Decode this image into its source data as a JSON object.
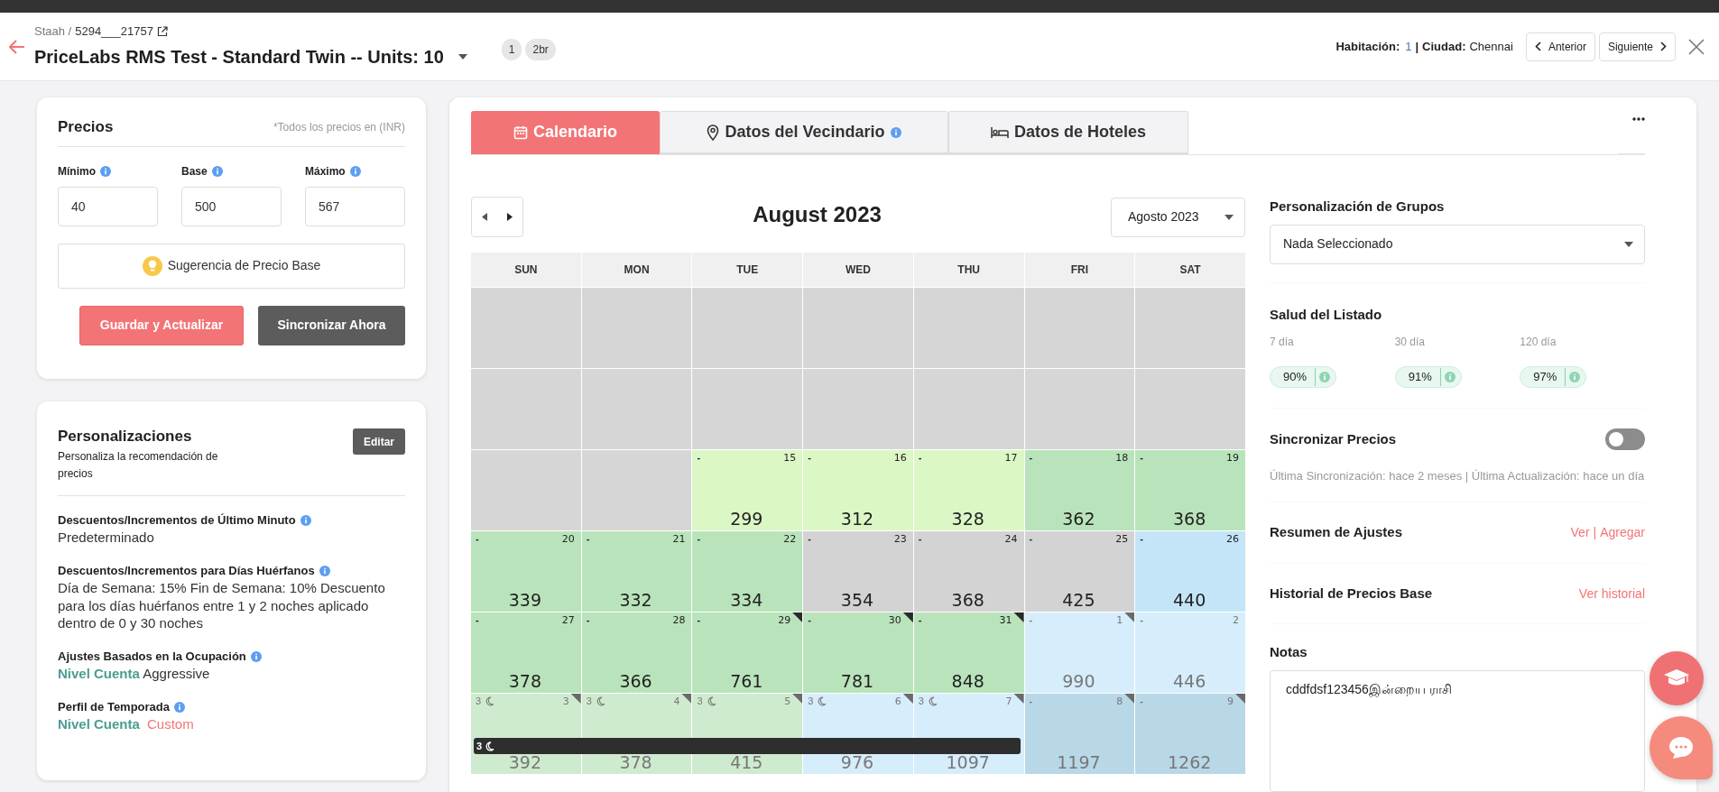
{
  "header": {
    "source": "Staah /",
    "listing_id": "5294___21757",
    "title": "PriceLabs RMS Test - Standard Twin -- Units: 10",
    "badges": [
      "1",
      "2br"
    ],
    "room_label": "Habitación:",
    "room": "1",
    "separator": "|",
    "city_label": "Ciudad:",
    "city": "Chennai",
    "prev_button": "Anterior",
    "next_button": "Siguiente"
  },
  "prices": {
    "title": "Precios",
    "currency_note": "*Todos los precios en (INR)",
    "fields": [
      {
        "label": "Mínimo",
        "value": "40"
      },
      {
        "label": "Base",
        "value": "500"
      },
      {
        "label": "Máximo",
        "value": "567"
      }
    ],
    "suggestion_button": "Sugerencia de Precio Base",
    "save_button": "Guardar y Actualizar",
    "sync_button": "Sincronizar Ahora"
  },
  "customizations": {
    "title": "Personalizaciones",
    "subtitle": "Personaliza la recomendación de precios",
    "edit_button": "Editar",
    "items": [
      {
        "title": "Descuentos/Incrementos de Último Minuto",
        "value": "Predeterminado"
      },
      {
        "title": "Descuentos/Incrementos para Días Huérfanos",
        "value": "Día de Semana: 15% Fin de Semana: 10% Descuento para los días huérfanos entre 1 y 2 noches aplicado dentro de 0 y 30 noches"
      },
      {
        "title": "Ajustes Basados en la Ocupación",
        "level_label": "Nivel Cuenta",
        "value": "Aggressive",
        "accent": false
      },
      {
        "title": "Perfil de Temporada",
        "level_label": "Nivel Cuenta",
        "value": "Custom",
        "accent": true
      }
    ]
  },
  "tabs": [
    {
      "label": "Calendario",
      "selected": true,
      "info": false
    },
    {
      "label": "Datos del Vecindario",
      "selected": false,
      "info": true
    },
    {
      "label": "Datos de Hoteles",
      "selected": false,
      "info": false
    }
  ],
  "calendar": {
    "month_title": "August 2023",
    "month_select": "Agosto 2023",
    "weekdays": [
      "SUN",
      "MON",
      "TUE",
      "WED",
      "THU",
      "FRI",
      "SAT"
    ],
    "weeks": [
      [
        {
          "kind": "empty"
        },
        {
          "kind": "empty"
        },
        {
          "kind": "empty"
        },
        {
          "kind": "empty"
        },
        {
          "kind": "empty"
        },
        {
          "kind": "empty"
        },
        {
          "kind": "empty"
        }
      ],
      [
        {
          "kind": "empty"
        },
        {
          "kind": "empty"
        },
        {
          "kind": "empty"
        },
        {
          "kind": "empty"
        },
        {
          "kind": "empty"
        },
        {
          "kind": "empty"
        },
        {
          "kind": "empty"
        }
      ],
      [
        {
          "kind": "empty"
        },
        {
          "kind": "empty"
        },
        {
          "kind": "day",
          "tag": "-",
          "day": "15",
          "price": "299",
          "color": "#dcf7c6",
          "faded": false,
          "flagged": false
        },
        {
          "kind": "day",
          "tag": "-",
          "day": "16",
          "price": "312",
          "color": "#dcf7c6",
          "faded": false,
          "flagged": false
        },
        {
          "kind": "day",
          "tag": "-",
          "day": "17",
          "price": "328",
          "color": "#dcf7c6",
          "faded": false,
          "flagged": false
        },
        {
          "kind": "day",
          "tag": "-",
          "day": "18",
          "price": "362",
          "color": "#b9e4bb",
          "faded": false,
          "flagged": false
        },
        {
          "kind": "day",
          "tag": "-",
          "day": "19",
          "price": "368",
          "color": "#b9e4bb",
          "faded": false,
          "flagged": false
        }
      ],
      [
        {
          "kind": "day",
          "tag": "-",
          "day": "20",
          "price": "339",
          "color": "#b9e4bb",
          "faded": false,
          "flagged": false
        },
        {
          "kind": "day",
          "tag": "-",
          "day": "21",
          "price": "332",
          "color": "#b9e4bb",
          "faded": false,
          "flagged": false
        },
        {
          "kind": "day",
          "tag": "-",
          "day": "22",
          "price": "334",
          "color": "#b9e4bb",
          "faded": false,
          "flagged": false
        },
        {
          "kind": "day",
          "tag": "-",
          "day": "23",
          "price": "354",
          "color": "#d3d3d3",
          "faded": false,
          "flagged": false
        },
        {
          "kind": "day",
          "tag": "-",
          "day": "24",
          "price": "368",
          "color": "#d3d3d3",
          "faded": false,
          "flagged": false
        },
        {
          "kind": "day",
          "tag": "-",
          "day": "25",
          "price": "425",
          "color": "#d3d3d3",
          "faded": false,
          "flagged": false
        },
        {
          "kind": "day",
          "tag": "-",
          "day": "26",
          "price": "440",
          "color": "#c4e5f8",
          "faded": false,
          "flagged": false
        }
      ],
      [
        {
          "kind": "day",
          "tag": "-",
          "day": "27",
          "price": "378",
          "color": "#b9e4bb",
          "faded": false,
          "flagged": false
        },
        {
          "kind": "day",
          "tag": "-",
          "day": "28",
          "price": "366",
          "color": "#b9e4bb",
          "faded": false,
          "flagged": false
        },
        {
          "kind": "day",
          "tag": "-",
          "day": "29",
          "price": "761",
          "color": "#b9e4bb",
          "faded": false,
          "flagged": true
        },
        {
          "kind": "day",
          "tag": "-",
          "day": "30",
          "price": "781",
          "color": "#b9e4bb",
          "faded": false,
          "flagged": true
        },
        {
          "kind": "day",
          "tag": "-",
          "day": "31",
          "price": "848",
          "color": "#b9e4bb",
          "faded": false,
          "flagged": true
        },
        {
          "kind": "day",
          "tag": "-",
          "day": "1",
          "price": "990",
          "color": "#d6edfb",
          "faded": true,
          "flagged": true
        },
        {
          "kind": "day",
          "tag": "-",
          "day": "2",
          "price": "446",
          "color": "#d6edfb",
          "faded": true,
          "flagged": false
        }
      ],
      [
        {
          "kind": "day",
          "stay": "3",
          "day": "3",
          "price": "392",
          "color": "#cfebcf",
          "faded": true,
          "flagged": true
        },
        {
          "kind": "day",
          "stay": "3",
          "day": "4",
          "price": "378",
          "color": "#cfebcf",
          "faded": true,
          "flagged": true
        },
        {
          "kind": "day",
          "stay": "3",
          "day": "5",
          "price": "415",
          "color": "#cfebcf",
          "faded": true,
          "flagged": true
        },
        {
          "kind": "day",
          "stay": "3",
          "day": "6",
          "price": "976",
          "color": "#d6edfb",
          "faded": true,
          "flagged": true
        },
        {
          "kind": "day",
          "stay": "3",
          "day": "7",
          "price": "1097",
          "color": "#d6edfb",
          "faded": true,
          "flagged": true
        },
        {
          "kind": "day",
          "tag": "-",
          "day": "8",
          "price": "1197",
          "color": "#b8d8e8",
          "faded": true,
          "flagged": true
        },
        {
          "kind": "day",
          "tag": "-",
          "day": "9",
          "price": "1262",
          "color": "#b8d8e8",
          "faded": true,
          "flagged": true
        }
      ]
    ],
    "stay_bar": "3"
  },
  "side": {
    "group_title": "Personalización de Grupos",
    "group_select": "Nada Seleccionado",
    "health_title": "Salud del Listado",
    "health": [
      {
        "label": "7 día",
        "value": "90%"
      },
      {
        "label": "30 día",
        "value": "91%"
      },
      {
        "label": "120 día",
        "value": "97%"
      }
    ],
    "sync_title": "Sincronizar Precios",
    "sync_on": false,
    "sync_note": "Última Sincronización: hace 2 meses | Última Actualización: hace un día",
    "summary_title": "Resumen de Ajustes",
    "summary_links": [
      "Ver",
      "Agregar"
    ],
    "summary_separator": "|",
    "history_title": "Historial de Precios Base",
    "history_link": "Ver historial",
    "notes_title": "Notas",
    "notes_value": "cddfdsf123456இன்றைய ராசி"
  }
}
